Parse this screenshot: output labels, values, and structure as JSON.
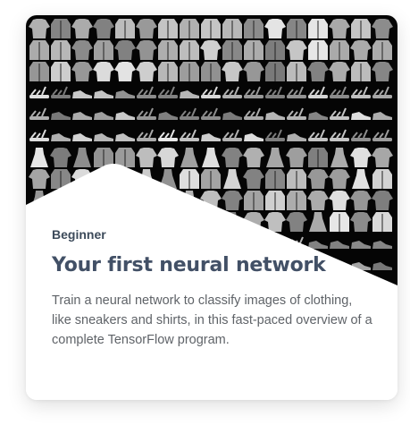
{
  "card": {
    "level": "Beginner",
    "title": "Your first neural network",
    "description": "Train a neural network to classify images of clothing, like sneakers and shirts, in this fast-paced overview of a complete TensorFlow program.",
    "image_icon": "fashion-mnist-grid-image"
  }
}
